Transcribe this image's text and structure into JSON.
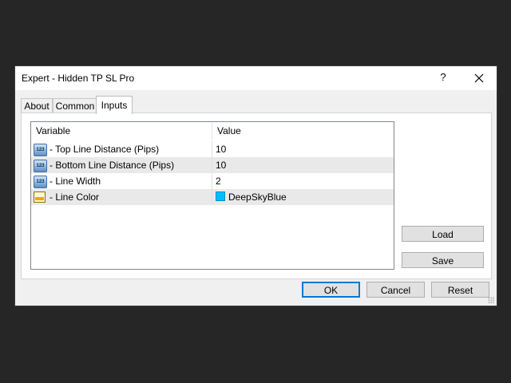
{
  "window": {
    "title": "Expert - Hidden TP SL Pro",
    "help_label": "?"
  },
  "tabs": [
    {
      "label": "About"
    },
    {
      "label": "Common"
    },
    {
      "label": "Inputs",
      "active": true
    }
  ],
  "inputs_table": {
    "columns": [
      "Variable",
      "Value"
    ],
    "rows": [
      {
        "icon": "number-123-icon",
        "variable": "- Top Line Distance (Pips)",
        "value": "10"
      },
      {
        "icon": "number-123-icon",
        "variable": "- Bottom Line Distance (Pips)",
        "value": "10"
      },
      {
        "icon": "number-123-icon",
        "variable": "- Line Width",
        "value": "2"
      },
      {
        "icon": "color-palette-icon",
        "variable": "- Line Color",
        "value": "DeepSkyBlue",
        "swatch_color": "#00BFFF"
      }
    ]
  },
  "side_buttons": {
    "load_label": "Load",
    "save_label": "Save"
  },
  "footer_buttons": {
    "ok_label": "OK",
    "cancel_label": "Cancel",
    "reset_label": "Reset"
  },
  "colors": {
    "accent": "#0078D7",
    "background": "#262626"
  }
}
